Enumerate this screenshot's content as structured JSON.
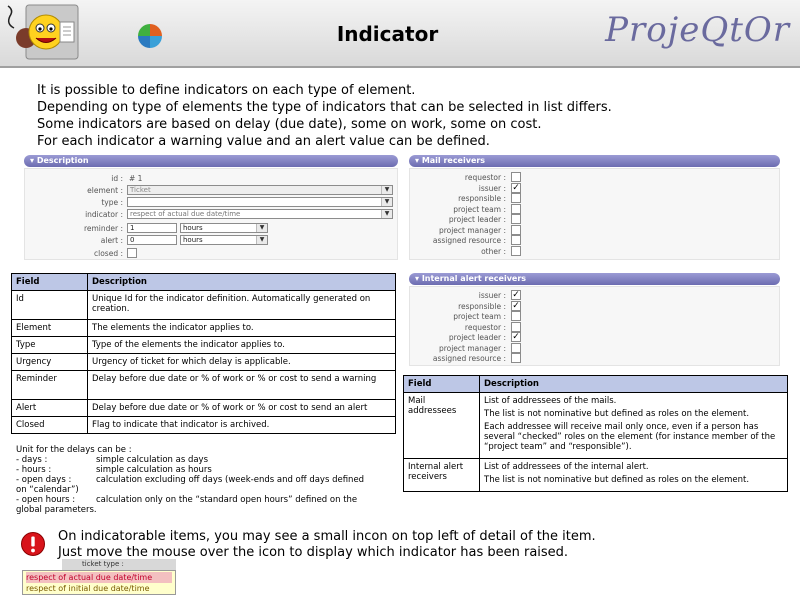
{
  "header": {
    "title": "Indicator",
    "brand": "ProjeQtOr"
  },
  "intro": [
    "It is possible to define indicators on each type of element.",
    "Depending on type of elements the type of indicators that can be selected in list differs.",
    "Some indicators are based on delay (due date), some on work, some on cost.",
    "For each indicator a warning value and an alert value can be defined."
  ],
  "description_panel": {
    "title": "Description",
    "id_label": "id :",
    "id_value": "# 1",
    "element_label": "element :",
    "element_value": "Ticket",
    "type_label": "type :",
    "type_value": "",
    "indicator_label": "indicator :",
    "indicator_value": "respect of actual due date/time",
    "reminder_label": "reminder :",
    "reminder_value": "1",
    "reminder_unit": "hours",
    "alert_label": "alert :",
    "alert_value": "0",
    "alert_unit": "hours",
    "closed_label": "closed :"
  },
  "mail_receivers": {
    "title": "Mail receivers",
    "items": [
      {
        "label": "requestor :",
        "checked": false
      },
      {
        "label": "issuer :",
        "checked": true
      },
      {
        "label": "responsible :",
        "checked": false
      },
      {
        "label": "project team :",
        "checked": false
      },
      {
        "label": "project leader :",
        "checked": false
      },
      {
        "label": "project manager :",
        "checked": false
      },
      {
        "label": "assigned resource :",
        "checked": false
      },
      {
        "label": "other :",
        "checked": false
      }
    ]
  },
  "internal_alert_receivers": {
    "title": "Internal alert receivers",
    "items": [
      {
        "label": "issuer :",
        "checked": true
      },
      {
        "label": "responsible :",
        "checked": true
      },
      {
        "label": "project team :",
        "checked": false
      },
      {
        "label": "requestor :",
        "checked": false
      },
      {
        "label": "project leader :",
        "checked": true
      },
      {
        "label": "project manager :",
        "checked": false
      },
      {
        "label": "assigned resource :",
        "checked": false
      }
    ]
  },
  "field_table": {
    "headers": [
      "Field",
      "Description"
    ],
    "rows": [
      [
        "Id",
        "Unique Id for the indicator definition. Automatically generated on creation."
      ],
      [
        "Element",
        "The elements the indicator applies to."
      ],
      [
        "Type",
        "Type of the elements the indicator applies to."
      ],
      [
        "Urgency",
        "Urgency of ticket for which delay is applicable."
      ],
      [
        "Reminder",
        "Delay before due date or % of work or % or cost to send a warning"
      ],
      [
        "Alert",
        "Delay before due date or % of work or % or cost to send an alert"
      ],
      [
        "Closed",
        "Flag to indicate that indicator is archived."
      ]
    ]
  },
  "receivers_table": {
    "headers": [
      "Field",
      "Description"
    ],
    "row1_field": "Mail addressees",
    "row1_p1": "List of addressees of the mails.",
    "row1_p2": "The list is not nominative but defined as roles on the element.",
    "row1_p3": "Each addressee will receive mail only once, even if a person has several “checked” roles on the element (for instance member of the “project team” and “responsible”).",
    "row2_field": "Internal alert receivers",
    "row2_p1": "List of addressees of the internal alert.",
    "row2_p2": "The list is not nominative but defined as roles on the element."
  },
  "units": {
    "title": "Unit for the delays can be :",
    "days_k": " - days :",
    "days_v": "simple calculation as days",
    "hours_k": " - hours :",
    "hours_v": "simple calculation as hours",
    "open_days_k": " - open days :",
    "open_days_v": "calculation excluding off days (week-ends and off days defined",
    "open_days_v2": "on “calendar”)",
    "open_hours_k": " - open hours :",
    "open_hours_v": "calculation only on the “standard open hours” defined on the",
    "open_hours_v2": "global parameters."
  },
  "bottom": {
    "line1": "On indicatorable items, you may see a small incon on top left of detail of the item.",
    "line2": "Just move the mouse over the icon to display which indicator has been raised.",
    "behind_label": "ticket type :",
    "tip1": "respect of actual due date/time",
    "tip2": "respect of initial due date/time"
  }
}
